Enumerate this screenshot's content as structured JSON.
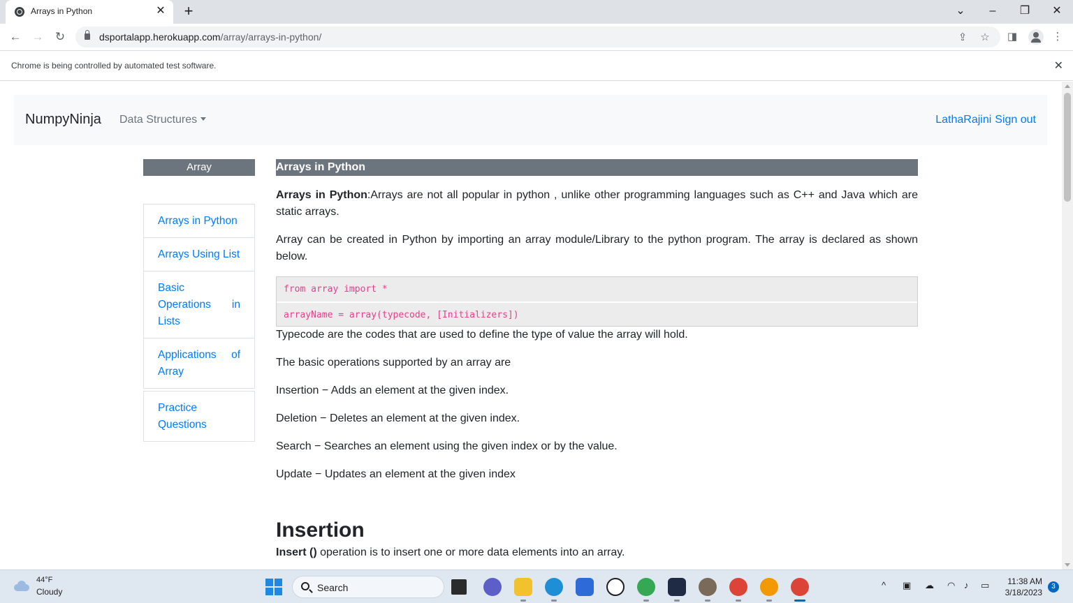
{
  "browser": {
    "tab_title": "Arrays in Python",
    "url_host": "dsportalapp.herokuapp.com",
    "url_path": "/array/arrays-in-python/",
    "infobar_message": "Chrome is being controlled by automated test software."
  },
  "navbar": {
    "brand": "NumpyNinja",
    "dropdown_label": "Data Structures",
    "user_name": "LathaRajini",
    "signout_label": "Sign out"
  },
  "sidebar": {
    "header": "Array",
    "topics": [
      {
        "label": "Arrays in Python"
      },
      {
        "label": "Arrays Using List"
      },
      {
        "label": "Basic Operations in Lists"
      },
      {
        "label": "Applications of Array"
      }
    ],
    "practice_label": "Practice Questions"
  },
  "content": {
    "header": "Arrays in Python",
    "intro_bold": "Arrays in Python",
    "intro_rest": ":Arrays are not all popular in python , unlike other programming languages such as C++ and Java which are static arrays.",
    "para2": "Array can be created in Python by importing an array module/Library to the python program. The array is declared as shown below.",
    "code": [
      "from array import *",
      "arrayName = array(typecode, [Initializers])"
    ],
    "para3": "Typecode are the codes that are used to define the type of value the array will hold.",
    "para4": "The basic operations supported by an array are",
    "ops": [
      "Insertion − Adds an element at the given index.",
      "Deletion − Deletes an element at the given index.",
      "Search − Searches an element using the given index or by the value.",
      "Update − Updates an element at the given index"
    ],
    "section_title": "Insertion",
    "insert_bold": "Insert ()",
    "insert_rest": " operation is to insert one or more data elements into an array."
  },
  "taskbar": {
    "temperature": "44°F",
    "condition": "Cloudy",
    "search_label": "Search",
    "time": "11:38 AM",
    "date": "3/18/2023",
    "notification_count": "3"
  },
  "colors": {
    "link": "#007bff",
    "header_bg": "#6c757d",
    "code_text": "#e83e8c"
  }
}
